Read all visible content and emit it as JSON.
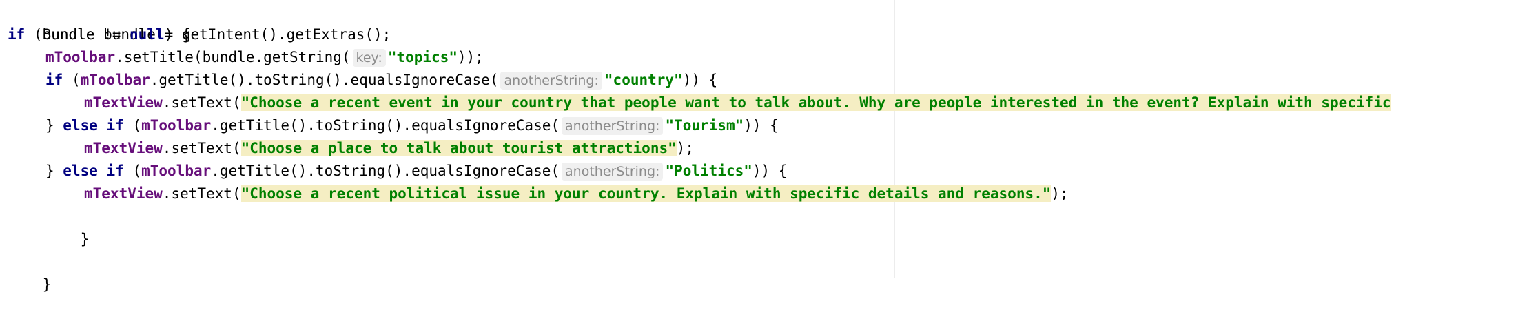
{
  "colors": {
    "keyword": "#000080",
    "field": "#660e7a",
    "string": "#008000",
    "string_highlight": "#f5eec3",
    "hint_text": "#8b8b8b",
    "hint_bg": "#f0f0f0"
  },
  "code": {
    "l1": {
      "text": "Bundle bundle = getIntent().getExtras();"
    },
    "l2": {
      "kw_if": "if",
      "pre": " (bundle != ",
      "kw_null": "null",
      "post": ") {"
    },
    "l3": {
      "field": "mToolbar",
      "pre": ".setTitle(bundle.getString(",
      "hint": "key:",
      "str": "\"topics\"",
      "post": "));"
    },
    "l4": {
      "kw_if": "if",
      "pre": " (",
      "field": "mToolbar",
      "mid": ".getTitle().toString().equalsIgnoreCase(",
      "hint": "anotherString:",
      "str": "\"country\"",
      "post": ")) {"
    },
    "l5": {
      "field": "mTextView",
      "pre": ".setText(",
      "str": "\"Choose a recent event in your country that people want to talk about. Why are people interested in the event? Explain with specific"
    },
    "l6": {
      "brace": "} ",
      "kw_else": "else",
      "space": " ",
      "kw_if": "if",
      "pre": " (",
      "field": "mToolbar",
      "mid": ".getTitle().toString().equalsIgnoreCase(",
      "hint": "anotherString:",
      "str": "\"Tourism\"",
      "post": ")) {"
    },
    "l7": {
      "field": "mTextView",
      "pre": ".setText(",
      "str": "\"Choose a place to talk about tourist attractions\"",
      "post": ");"
    },
    "l8": {
      "brace": "} ",
      "kw_else": "else",
      "space": " ",
      "kw_if": "if",
      "pre": " (",
      "field": "mToolbar",
      "mid": ".getTitle().toString().equalsIgnoreCase(",
      "hint": "anotherString:",
      "str": "\"Politics\"",
      "post": ")) {"
    },
    "l9": {
      "field": "mTextView",
      "pre": ".setText(",
      "str": "\"Choose a recent political issue in your country. Explain with specific details and reasons.\"",
      "post": ");"
    },
    "l10": {
      "text": "}"
    },
    "l12": {
      "text": "}"
    }
  }
}
